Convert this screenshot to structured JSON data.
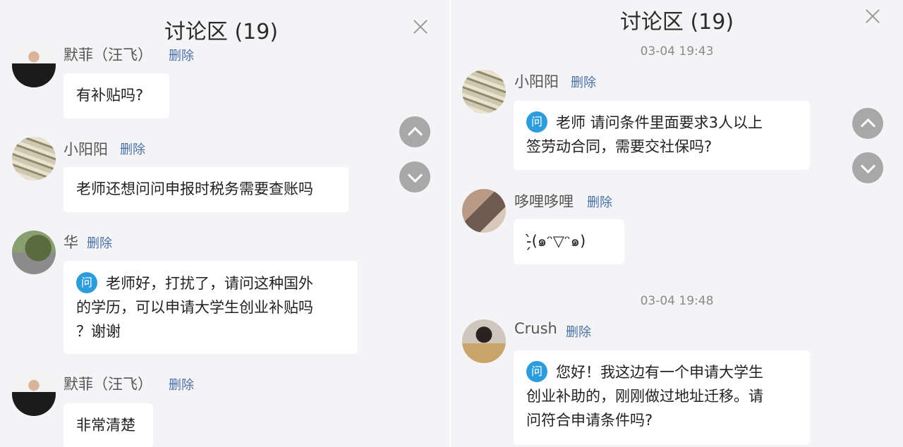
{
  "left": {
    "title": "讨论区 (19)",
    "messages": [
      {
        "user": "默菲（汪飞）",
        "delete": "删除",
        "text": "有补贴吗?"
      },
      {
        "user": "小阳阳",
        "delete": "删除",
        "text": "老师还想问问申报时税务需要查账吗"
      },
      {
        "user": "华",
        "delete": "删除",
        "badge": "问",
        "lines": [
          "老师好，打扰了，请问这种国外",
          "的学历，可以申请大学生创业补贴吗",
          "？谢谢"
        ]
      },
      {
        "user": "默菲（汪飞）",
        "delete": "删除",
        "text": "非常清楚"
      }
    ]
  },
  "right": {
    "title": "讨论区 (19)",
    "times": [
      "03-04 19:43",
      "03-04 19:48"
    ],
    "messages": [
      {
        "user": "小阳阳",
        "delete": "删除",
        "badge": "问",
        "lines": [
          "老师 请问条件里面要求3人以上",
          "签劳动合同，需要交社保吗?"
        ]
      },
      {
        "user": "哆哩哆哩",
        "delete": "删除",
        "text": "-̗̀(๑ᵔ▽ᵔ๑)"
      },
      {
        "user": "Crush",
        "delete": "删除",
        "badge": "问",
        "lines": [
          "您好！我这边有一个申请大学生",
          "创业补助的，刚刚做过地址迁移。请",
          "问符合申请条件吗?"
        ]
      }
    ]
  },
  "icons": {
    "close": "close-icon",
    "up": "chevron-up-icon",
    "down": "chevron-down-icon"
  },
  "colors": {
    "badge": "#2d9cdb",
    "delete_link": "#4a6fa5",
    "background": "#f4f4f6"
  }
}
